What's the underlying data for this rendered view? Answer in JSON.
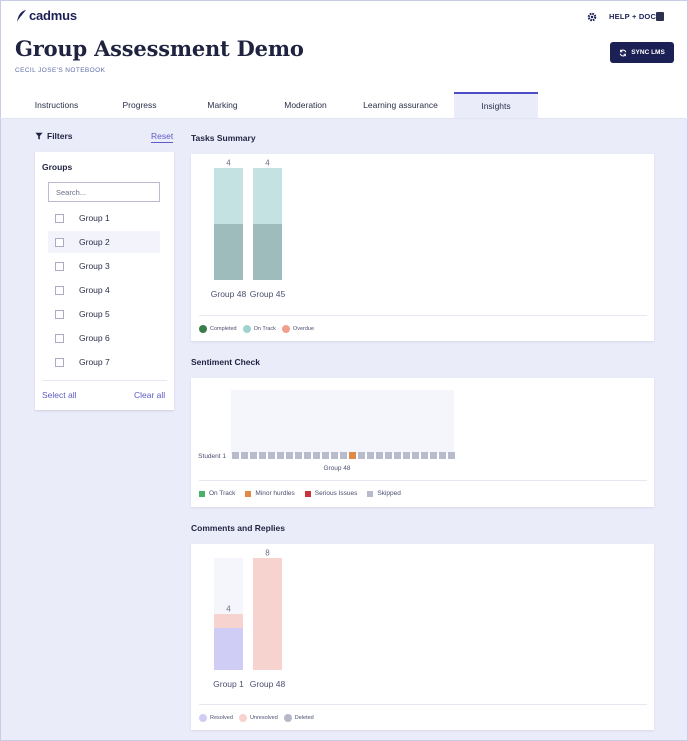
{
  "app": {
    "logo_text": "cadmus",
    "help_label": "HELP + DOCS"
  },
  "page": {
    "title": "Group Assessment Demo",
    "subtitle": "CECIL JOSE'S NOTEBOOK",
    "sync_label": "SYNC LMS"
  },
  "tabs": [
    {
      "label": "Instructions",
      "active": false
    },
    {
      "label": "Progress",
      "active": false
    },
    {
      "label": "Marking",
      "active": false
    },
    {
      "label": "Moderation",
      "active": false
    },
    {
      "label": "Learning assurance",
      "active": false
    },
    {
      "label": "Insights",
      "active": true
    }
  ],
  "filters": {
    "title": "Filters",
    "reset_label": "Reset",
    "groups_title": "Groups",
    "search_placeholder": "Search...",
    "groups": [
      "Group 1",
      "Group 2",
      "Group 3",
      "Group 4",
      "Group 5",
      "Group 6",
      "Group 7"
    ],
    "select_all_label": "Select all",
    "clear_all_label": "Clear all"
  },
  "sections": {
    "tasks_summary": "Tasks Summary",
    "sentiment_check": "Sentiment Check",
    "comments_replies": "Comments and Replies"
  },
  "chart_data": [
    {
      "type": "bar",
      "stacked": true,
      "categories": [
        "Group 48",
        "Group 45"
      ],
      "totals": [
        4,
        4
      ],
      "series": [
        {
          "name": "Completed",
          "values": [
            0,
            0
          ],
          "color": "#3a7d4a"
        },
        {
          "name": "On Track",
          "values": [
            4,
            4
          ],
          "color": "#9fd3cf"
        },
        {
          "name": "Overdue",
          "values": [
            0,
            0
          ],
          "color": "#f2a08e"
        }
      ],
      "ylim": [
        0,
        4
      ]
    },
    {
      "type": "heatmap",
      "row_labels": [
        "Student 1"
      ],
      "group_label": "Group 48",
      "cell_count": 25,
      "cells": [
        "Skipped",
        "Skipped",
        "Skipped",
        "Skipped",
        "Skipped",
        "Skipped",
        "Skipped",
        "Skipped",
        "Skipped",
        "Skipped",
        "Skipped",
        "Skipped",
        "Skipped",
        "Minor hurdles",
        "Skipped",
        "Skipped",
        "Skipped",
        "Skipped",
        "Skipped",
        "Skipped",
        "Skipped",
        "Skipped",
        "Skipped",
        "Skipped",
        "Skipped"
      ],
      "legend": [
        {
          "name": "On Track",
          "color": "#4caf6a"
        },
        {
          "name": "Minor hurdles",
          "color": "#e08a4a"
        },
        {
          "name": "Serious Issues",
          "color": "#c9343a"
        },
        {
          "name": "Skipped",
          "color": "#b8bbcc"
        }
      ]
    },
    {
      "type": "bar",
      "stacked": true,
      "categories": [
        "Group 1",
        "Group 48"
      ],
      "totals": [
        4,
        8
      ],
      "series": [
        {
          "name": "Resolved",
          "values": [
            3,
            0
          ],
          "color": "#cfcdf5"
        },
        {
          "name": "Unresolved",
          "values": [
            1,
            8
          ],
          "color": "#f6d3cf"
        },
        {
          "name": "Deleted",
          "values": [
            0,
            0
          ],
          "color": "#b4b8c8"
        }
      ],
      "ylim": [
        0,
        8
      ]
    }
  ],
  "colors": {
    "brand": "#1b2155",
    "accent": "#5e5bc4",
    "panel_bg": "#ebecfa"
  }
}
